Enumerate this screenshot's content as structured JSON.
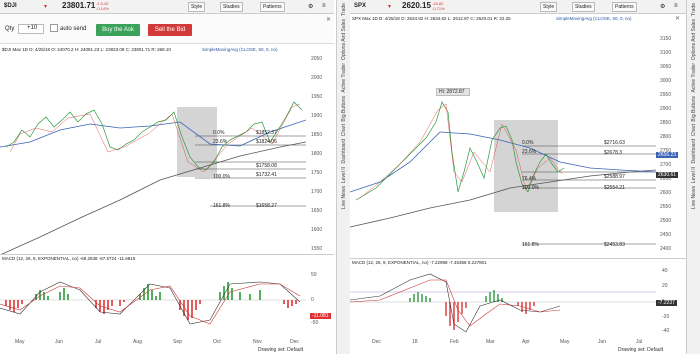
{
  "left": {
    "symbol": "$DJI",
    "price": "23801.71",
    "chg": "-1.0.42",
    "chg2": "-0.14%",
    "buttons": [
      "Style",
      "Studies",
      "Patterns"
    ],
    "order": {
      "qty_label": "Qty",
      "qty": "+10",
      "auto_send": "auto send",
      "buy": "Buy the Ask",
      "sell": "Sell the Bid"
    },
    "ohlc": "$DJI Max 1D  D: 4/25/18  O: 24070.2  H: 24081.23  L: 23823.08  C: 23801.71  R: 268.10",
    "study": "SimpleMovingAvg (CLOSE, 50, 0, no)",
    "y_ticks": [
      "2050",
      "2000",
      "1950",
      "1900",
      "1850",
      "1800",
      "1750",
      "1700",
      "1650",
      "1600",
      "1550"
    ],
    "price_badge": "1911.45",
    "fib": [
      [
        "0.0%",
        "$1852.37"
      ],
      [
        "23.6%",
        "$1824.06"
      ],
      [
        "",
        "$1758.08"
      ],
      [
        "",
        "$1732.41"
      ],
      [
        "100.0%",
        ""
      ],
      [
        "161.8%",
        "$1658.27"
      ]
    ],
    "macd_label": "MACD (12, 26, 9, EXPONENTIAL, no)  -69.2538  -57.5724  -11.6815",
    "macd_ticks": [
      "50",
      "0",
      "-50"
    ],
    "macd_badge": "-11.081",
    "x_ticks": [
      "May",
      "Jun",
      "Jul",
      "Aug",
      "Sep",
      "Oct",
      "Nov",
      "Dec"
    ],
    "footer": "Drawing set: Default"
  },
  "right": {
    "symbol": "SPX",
    "price": "2620.15",
    "chg": "-18.82",
    "chg2": "-0.71%",
    "buttons": [
      "Style",
      "Studies",
      "Patterns"
    ],
    "ohlc": "SPX Max 1D  D: 4/25/18  O: 2634.82  H: 2634.82  L: 2612.67  C: 2620.01  R: 22.25",
    "study": "SimpleMovingAvg (CLOSE, 50, 0, no)",
    "hi_label": "Hi: 2872.87",
    "y_ticks": [
      "3150",
      "3100",
      "3050",
      "3000",
      "2950",
      "2900",
      "2850",
      "2800",
      "2750",
      "2700",
      "2650",
      "2600",
      "2550",
      "2500",
      "2450",
      "2400"
    ],
    "badges": [
      "2656.23",
      "2630.61"
    ],
    "fib": [
      [
        "0.0%",
        "$2716.63"
      ],
      [
        "23.6%",
        "$2678.3"
      ],
      [
        "",
        "$2588.97"
      ],
      [
        "76.4%",
        ""
      ],
      [
        "100.0%",
        "$2554.21"
      ],
      [
        "161.8%",
        "$2453.83"
      ]
    ],
    "macd_label": "MACD (12, 26, 9, EXPONENTIAL, no)  -7.22998  -7.45358  0.227801",
    "macd_ticks": [
      "40",
      "20",
      "0",
      "-20",
      "-40"
    ],
    "macd_badge": "-7.2237",
    "x_ticks": [
      "Dec",
      "18",
      "Feb",
      "Mar",
      "Apr",
      "May",
      "Jun",
      "Jul"
    ],
    "footer": "Drawing set: Default"
  },
  "sidebar": [
    "Trade",
    "Options And Sales",
    "Active Trader",
    "Big Buttons",
    "Chart",
    "Dashboard",
    "Level II",
    "Live News"
  ]
}
